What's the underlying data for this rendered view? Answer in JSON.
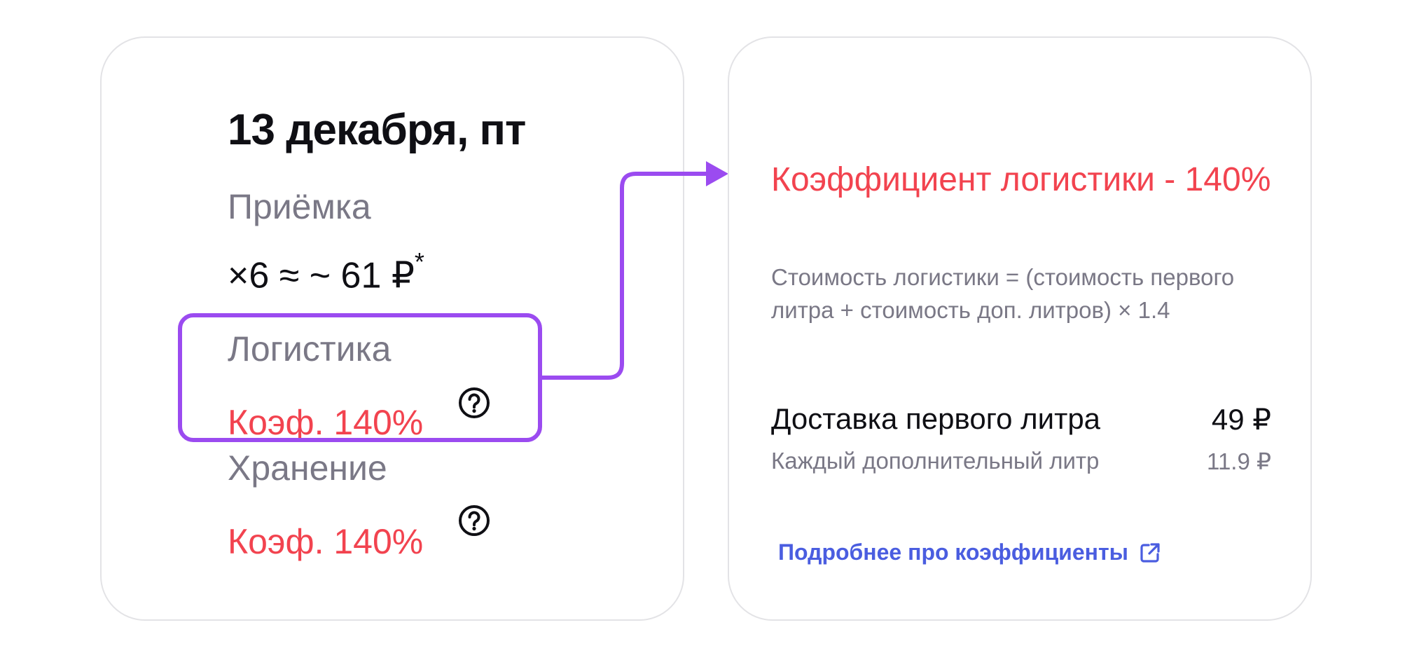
{
  "left_card": {
    "date": "13 декабря, пт",
    "priemka": {
      "label": "Приёмка",
      "value": "×6 ≈ ~ 61 ₽",
      "footnote_mark": "*"
    },
    "logistika": {
      "label": "Логистика",
      "value": "Коэф. 140%",
      "help_icon": "question-circle-icon"
    },
    "hranenie": {
      "label": "Хранение",
      "value": "Коэф. 140%",
      "help_icon": "question-circle-icon"
    }
  },
  "right_card": {
    "title": "Коэффициент логистики - 140%",
    "formula": "Стоимость логистики = (стоимость первого литра + стоимость доп. литров) × 1.4",
    "rows": [
      {
        "label": "Доставка первого литра",
        "value": "49 ₽"
      },
      {
        "label": "Каждый дополнительный литр",
        "value": "11.9 ₽"
      }
    ],
    "link_text": "Подробнее про коэффициенты",
    "link_icon": "external-link-icon"
  },
  "colors": {
    "accent_red": "#f2434f",
    "highlight_purple": "#9b4bf0",
    "link_blue": "#4a5de0",
    "muted_gray": "#7a7886"
  }
}
